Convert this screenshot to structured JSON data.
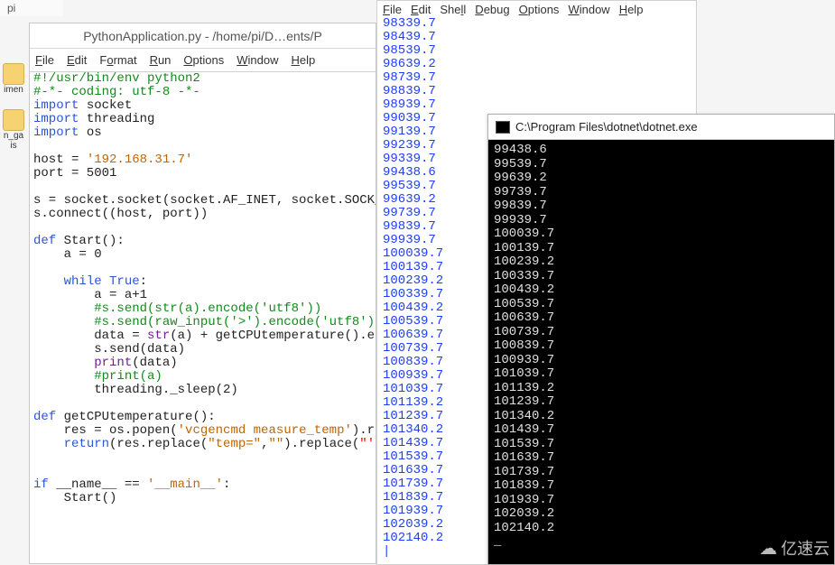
{
  "tab": "pi",
  "left_icons": [
    "imen",
    "n_ga",
    "is"
  ],
  "ide": {
    "title": "PythonApplication.py - /home/pi/D…ents/P",
    "menu": {
      "file": "File",
      "edit": "Edit",
      "format": "Format",
      "run": "Run",
      "options": "Options",
      "window": "Window",
      "help": "Help"
    },
    "code": {
      "l1": "#!/usr/bin/env python2",
      "l2": "#-*- coding: utf-8 -*-",
      "l3a": "import",
      "l3b": " socket",
      "l4a": "import",
      "l4b": " threading",
      "l5a": "import",
      "l5b": " os",
      "l7a": "host = ",
      "l7b": "'192.168.31.7'",
      "l8": "port = 5001",
      "l10": "s = socket.socket(socket.AF_INET, socket.SOCK_S",
      "l11": "s.connect((host, port))",
      "l13a": "def",
      "l13b": " Start():",
      "l14": "    a = 0",
      "l16a": "    ",
      "l16b": "while",
      "l16c": " ",
      "l16d": "True",
      "l16e": ":",
      "l17": "        a = a+1",
      "l18": "        #s.send(str(a).encode('utf8'))",
      "l19": "        #s.send(raw_input('>').encode('utf8'))",
      "l20a": "        data = ",
      "l20b": "str",
      "l20c": "(a) + getCPUtemperature().enc",
      "l21": "        s.send(data)",
      "l22a": "        ",
      "l22b": "print",
      "l22c": "(data)",
      "l23": "        #print(a)",
      "l24": "        threading._sleep(2)",
      "l26a": "def",
      "l26b": " getCPUtemperature():",
      "l27a": "    res = os.popen(",
      "l27b": "'vcgencmd measure_temp'",
      "l27c": ").rea",
      "l28a": "    ",
      "l28b": "return",
      "l28c": "(res.replace(",
      "l28d": "\"temp=\"",
      "l28e": ",",
      "l28f": "\"\"",
      "l28g": ").replace(",
      "l28h": "\"'C\\",
      "l31a": "if",
      "l31b": " __name__ == ",
      "l31c": "'__main__'",
      "l31d": ":",
      "l32": "    Start()"
    }
  },
  "shell": {
    "menu": {
      "file": "File",
      "edit": "Edit",
      "shell": "Shell",
      "debug": "Debug",
      "options": "Options",
      "window": "Window",
      "help": "Help"
    },
    "lines": [
      "98339.7",
      "98439.7",
      "98539.7",
      "98639.2",
      "98739.7",
      "98839.7",
      "98939.7",
      "99039.7",
      "99139.7",
      "99239.7",
      "99339.7",
      "99438.6",
      "99539.7",
      "99639.2",
      "99739.7",
      "99839.7",
      "99939.7",
      "100039.7",
      "100139.7",
      "100239.2",
      "100339.7",
      "100439.2",
      "100539.7",
      "100639.7",
      "100739.7",
      "100839.7",
      "100939.7",
      "101039.7",
      "101139.2",
      "101239.7",
      "101340.2",
      "101439.7",
      "101539.7",
      "101639.7",
      "101739.7",
      "101839.7",
      "101939.7",
      "102039.2",
      "102140.2"
    ]
  },
  "console": {
    "title": "C:\\Program Files\\dotnet\\dotnet.exe",
    "lines": [
      "99438.6",
      "99539.7",
      "99639.2",
      "99739.7",
      "99839.7",
      "99939.7",
      "100039.7",
      "100139.7",
      "100239.2",
      "100339.7",
      "100439.2",
      "100539.7",
      "100639.7",
      "100739.7",
      "100839.7",
      "100939.7",
      "101039.7",
      "101139.2",
      "101239.7",
      "101340.2",
      "101439.7",
      "101539.7",
      "101639.7",
      "101739.7",
      "101839.7",
      "101939.7",
      "102039.2",
      "102140.2"
    ],
    "cursor": "_"
  },
  "watermark": {
    "icon": "☁",
    "text": "亿速云"
  }
}
